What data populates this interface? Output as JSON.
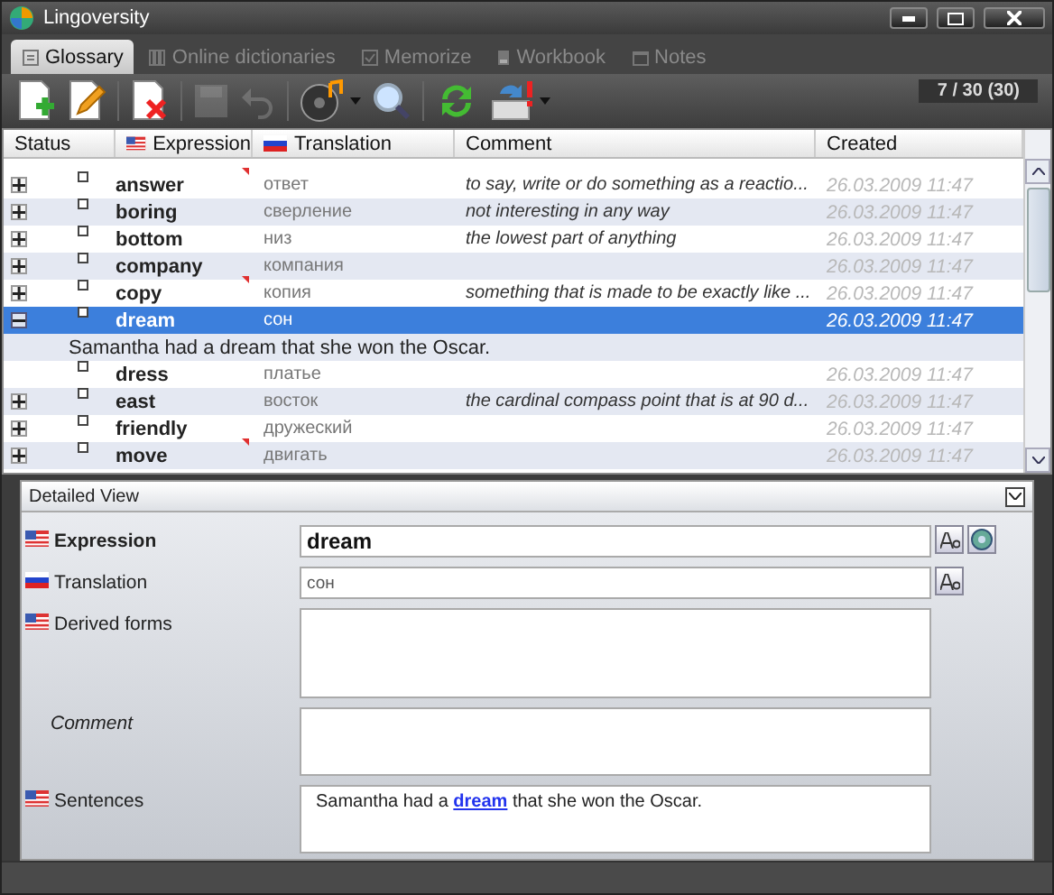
{
  "window": {
    "title": "Lingoversity"
  },
  "tabs": [
    {
      "label": "Glossary",
      "selected": true,
      "kind": "glossary"
    },
    {
      "label": "Online dictionaries",
      "selected": false,
      "kind": "dictionaries"
    },
    {
      "label": "Memorize",
      "selected": false,
      "kind": "memorize"
    },
    {
      "label": "Workbook",
      "selected": false,
      "kind": "workbook"
    },
    {
      "label": "Notes",
      "selected": false,
      "kind": "notes"
    }
  ],
  "toolbar": {
    "buttons": [
      {
        "kind": "new",
        "disabled": false,
        "dropdown": false
      },
      {
        "kind": "edit",
        "disabled": false,
        "dropdown": false
      },
      {
        "kind": "delete",
        "disabled": false,
        "dropdown": false
      },
      {
        "kind": "save",
        "disabled": true,
        "dropdown": false
      },
      {
        "kind": "undo",
        "disabled": true,
        "dropdown": false
      },
      {
        "kind": "sound",
        "disabled": false,
        "dropdown": true
      },
      {
        "kind": "search",
        "disabled": false,
        "dropdown": false
      },
      {
        "kind": "sync",
        "disabled": false,
        "dropdown": false
      },
      {
        "kind": "export",
        "disabled": false,
        "dropdown": true
      }
    ],
    "counter": "7 / 30 (30)"
  },
  "table": {
    "columns": [
      {
        "label": "Status",
        "kind": "status"
      },
      {
        "label": "Expression",
        "kind": "expression"
      },
      {
        "label": "Translation",
        "kind": "translation"
      },
      {
        "label": "Comment",
        "kind": "comment"
      },
      {
        "label": "Created",
        "kind": "created"
      }
    ],
    "rows": [
      {
        "kind": "collapsed",
        "expression": "answer",
        "translation": "ответ",
        "comment": "to say, write or do something as a reactio...",
        "created": "26.03.2009 11:47",
        "selected": false,
        "note": true
      },
      {
        "kind": "collapsed",
        "expression": "boring",
        "translation": "сверление",
        "comment": "not interesting in any way",
        "created": "26.03.2009 11:47",
        "selected": false,
        "note": false
      },
      {
        "kind": "collapsed",
        "expression": "bottom",
        "translation": "низ",
        "comment": "the lowest part of anything",
        "created": "26.03.2009 11:47",
        "selected": false,
        "note": false
      },
      {
        "kind": "collapsed",
        "expression": "company",
        "translation": "компания",
        "created": "26.03.2009 11:47",
        "selected": false,
        "note": false
      },
      {
        "kind": "collapsed",
        "expression": "copy",
        "translation": "копия",
        "comment": "something that is made to be exactly like ...",
        "created": "26.03.2009 11:47",
        "selected": false,
        "note": true
      },
      {
        "kind": "expanded",
        "expression": "dream",
        "translation": "сон",
        "created": "26.03.2009 11:47",
        "selected": true,
        "note": false,
        "sentence": "Samantha had a dream that she won the Oscar."
      },
      {
        "kind": "leaf",
        "expression": "dress",
        "translation": "платье",
        "created": "26.03.2009 11:47",
        "selected": false,
        "note": false
      },
      {
        "kind": "collapsed",
        "expression": "east",
        "translation": "восток",
        "comment": "the cardinal compass point that is at 90 d...",
        "created": "26.03.2009 11:47",
        "selected": false,
        "note": false
      },
      {
        "kind": "collapsed",
        "expression": "friendly",
        "translation": "дружеский",
        "created": "26.03.2009 11:47",
        "selected": false,
        "note": false
      },
      {
        "kind": "collapsed",
        "expression": "move",
        "translation": "двигать",
        "created": "26.03.2009 11:47",
        "selected": false,
        "note": true
      }
    ]
  },
  "detail": {
    "title": "Detailed View",
    "fields": [
      {
        "label": "Expression",
        "kind": "expression",
        "value": "dream"
      },
      {
        "label": "Translation",
        "kind": "translation",
        "value": "сон"
      },
      {
        "label": "Derived forms",
        "kind": "derived"
      },
      {
        "label": "Comment",
        "kind": "comment"
      },
      {
        "label": "Sentences",
        "kind": "sentences",
        "before": "Samantha had a",
        "link": "dream",
        "after": "that she won the Oscar."
      }
    ]
  }
}
